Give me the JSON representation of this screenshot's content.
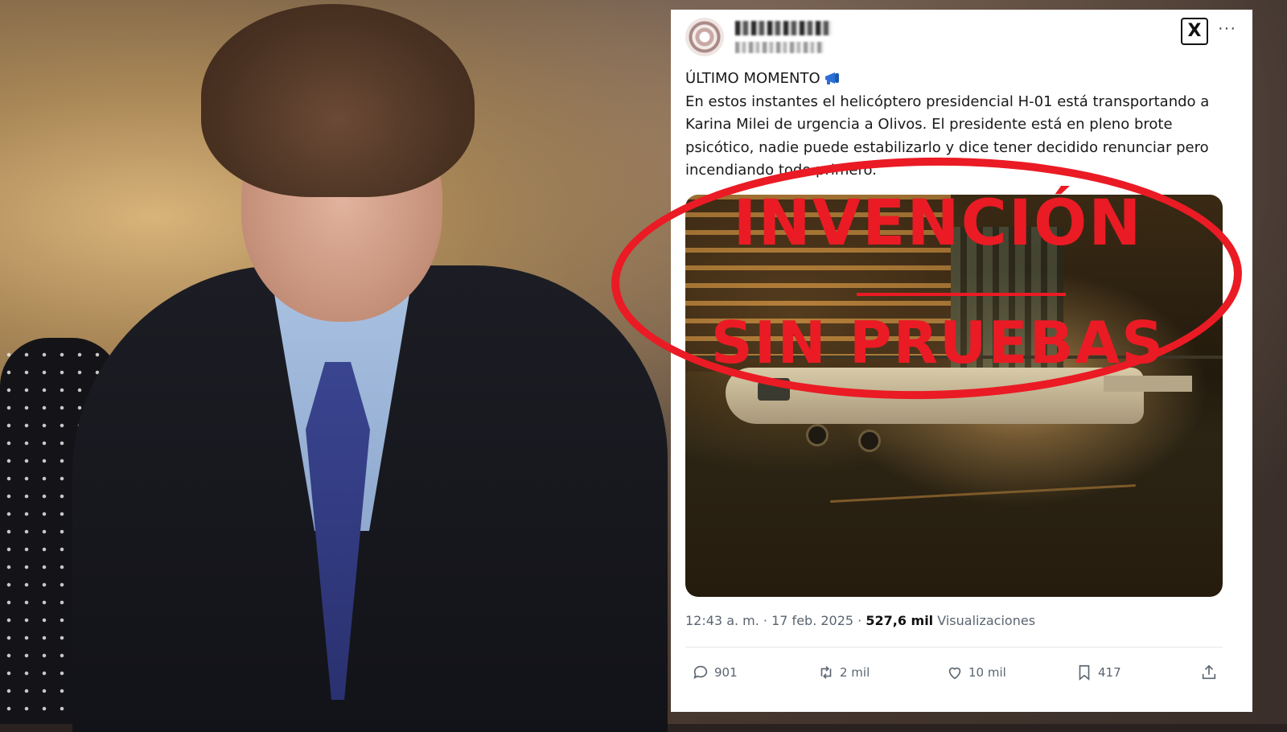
{
  "tweet": {
    "headline": "ÚLTIMO MOMENTO",
    "body": "En estos instantes el helicóptero presidencial H-01 está transportando a Karina Milei de urgencia a Olivos. El presidente está en pleno brote psicótico, nadie puede estabilizarlo y dice tener decidido renunciar pero incendiando todo primero.",
    "time": "12:43 a. m.",
    "date": "17 feb. 2025",
    "views_count": "527,6 mil",
    "views_label": "Visualizaciones",
    "replies": "901",
    "reposts": "2 mil",
    "likes": "10 mil",
    "bookmarks": "417"
  },
  "stamp": {
    "line1": "INVENCIÓN",
    "line2": "SIN PRUEBAS",
    "color": "#ea1b24"
  },
  "icons": [
    "avatar",
    "x-logo-icon",
    "more-icon",
    "megaphone-icon",
    "reply-icon",
    "repost-icon",
    "like-icon",
    "bookmark-icon",
    "share-icon"
  ]
}
